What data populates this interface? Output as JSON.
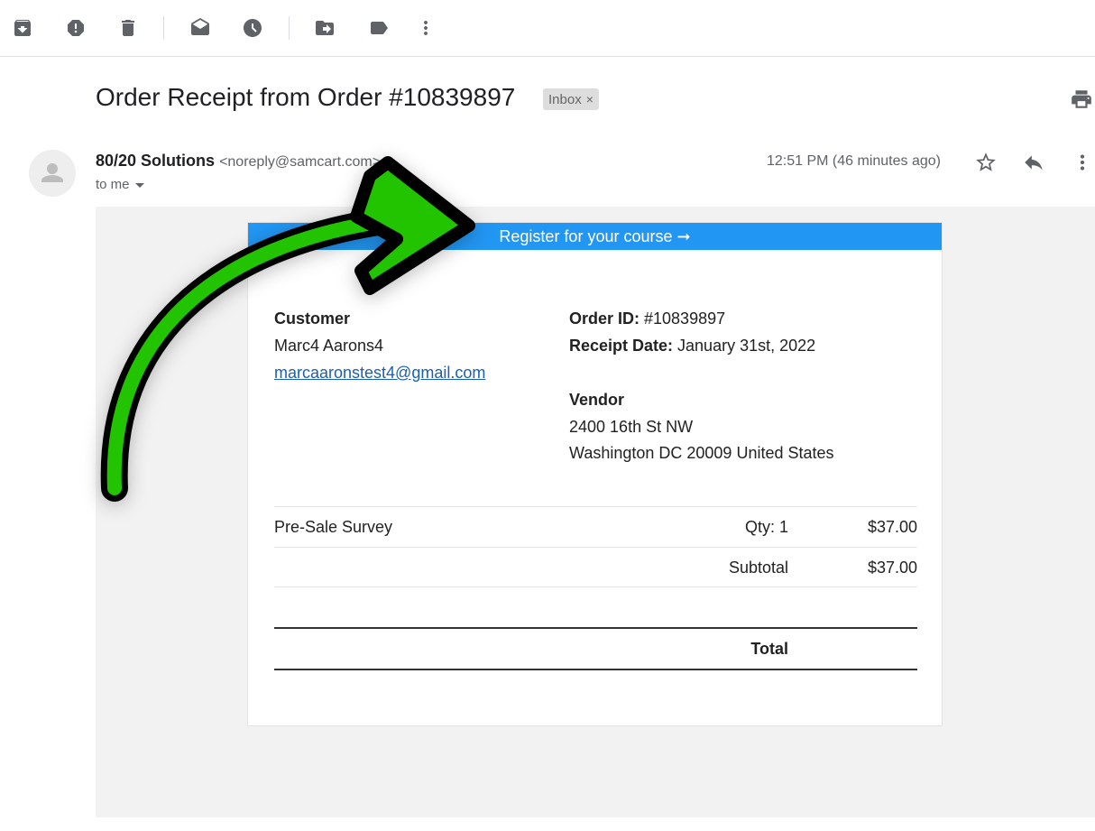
{
  "toolbar": {
    "icons": [
      "archive-icon",
      "report-spam-icon",
      "delete-icon",
      "mark-unread-icon",
      "snooze-icon",
      "move-to-icon",
      "label-icon",
      "more-icon"
    ]
  },
  "email": {
    "subject": "Order Receipt from Order #10839897",
    "label": "Inbox",
    "label_close": "×",
    "sender_name": "80/20 Solutions",
    "sender_addr": "<noreply@samcart.com>",
    "to": "to me",
    "time": "12:51 PM (46 minutes ago)"
  },
  "receipt": {
    "banner": "Register for your course ➞",
    "customer_heading": "Customer",
    "customer_name": "Marc4 Aarons4",
    "customer_email": "marcaaronstest4@gmail.com",
    "order_id_label": "Order ID:",
    "order_id": " #10839897",
    "receipt_date_label": "Receipt Date:",
    "receipt_date": " January 31st, 2022",
    "vendor_heading": "Vendor",
    "vendor_line1": "2400 16th St NW",
    "vendor_line2": "Washington DC 20009 United States",
    "item_name": "Pre-Sale Survey",
    "item_qty": "Qty: 1",
    "item_price": "$37.00",
    "subtotal_label": "Subtotal",
    "subtotal_value": "$37.00",
    "total_label": "Total",
    "total_value": ""
  },
  "colors": {
    "banner": "#2196f3",
    "arrow_fill": "#22c400",
    "arrow_stroke": "#000000",
    "mail_bg": "#f2f2f2"
  }
}
